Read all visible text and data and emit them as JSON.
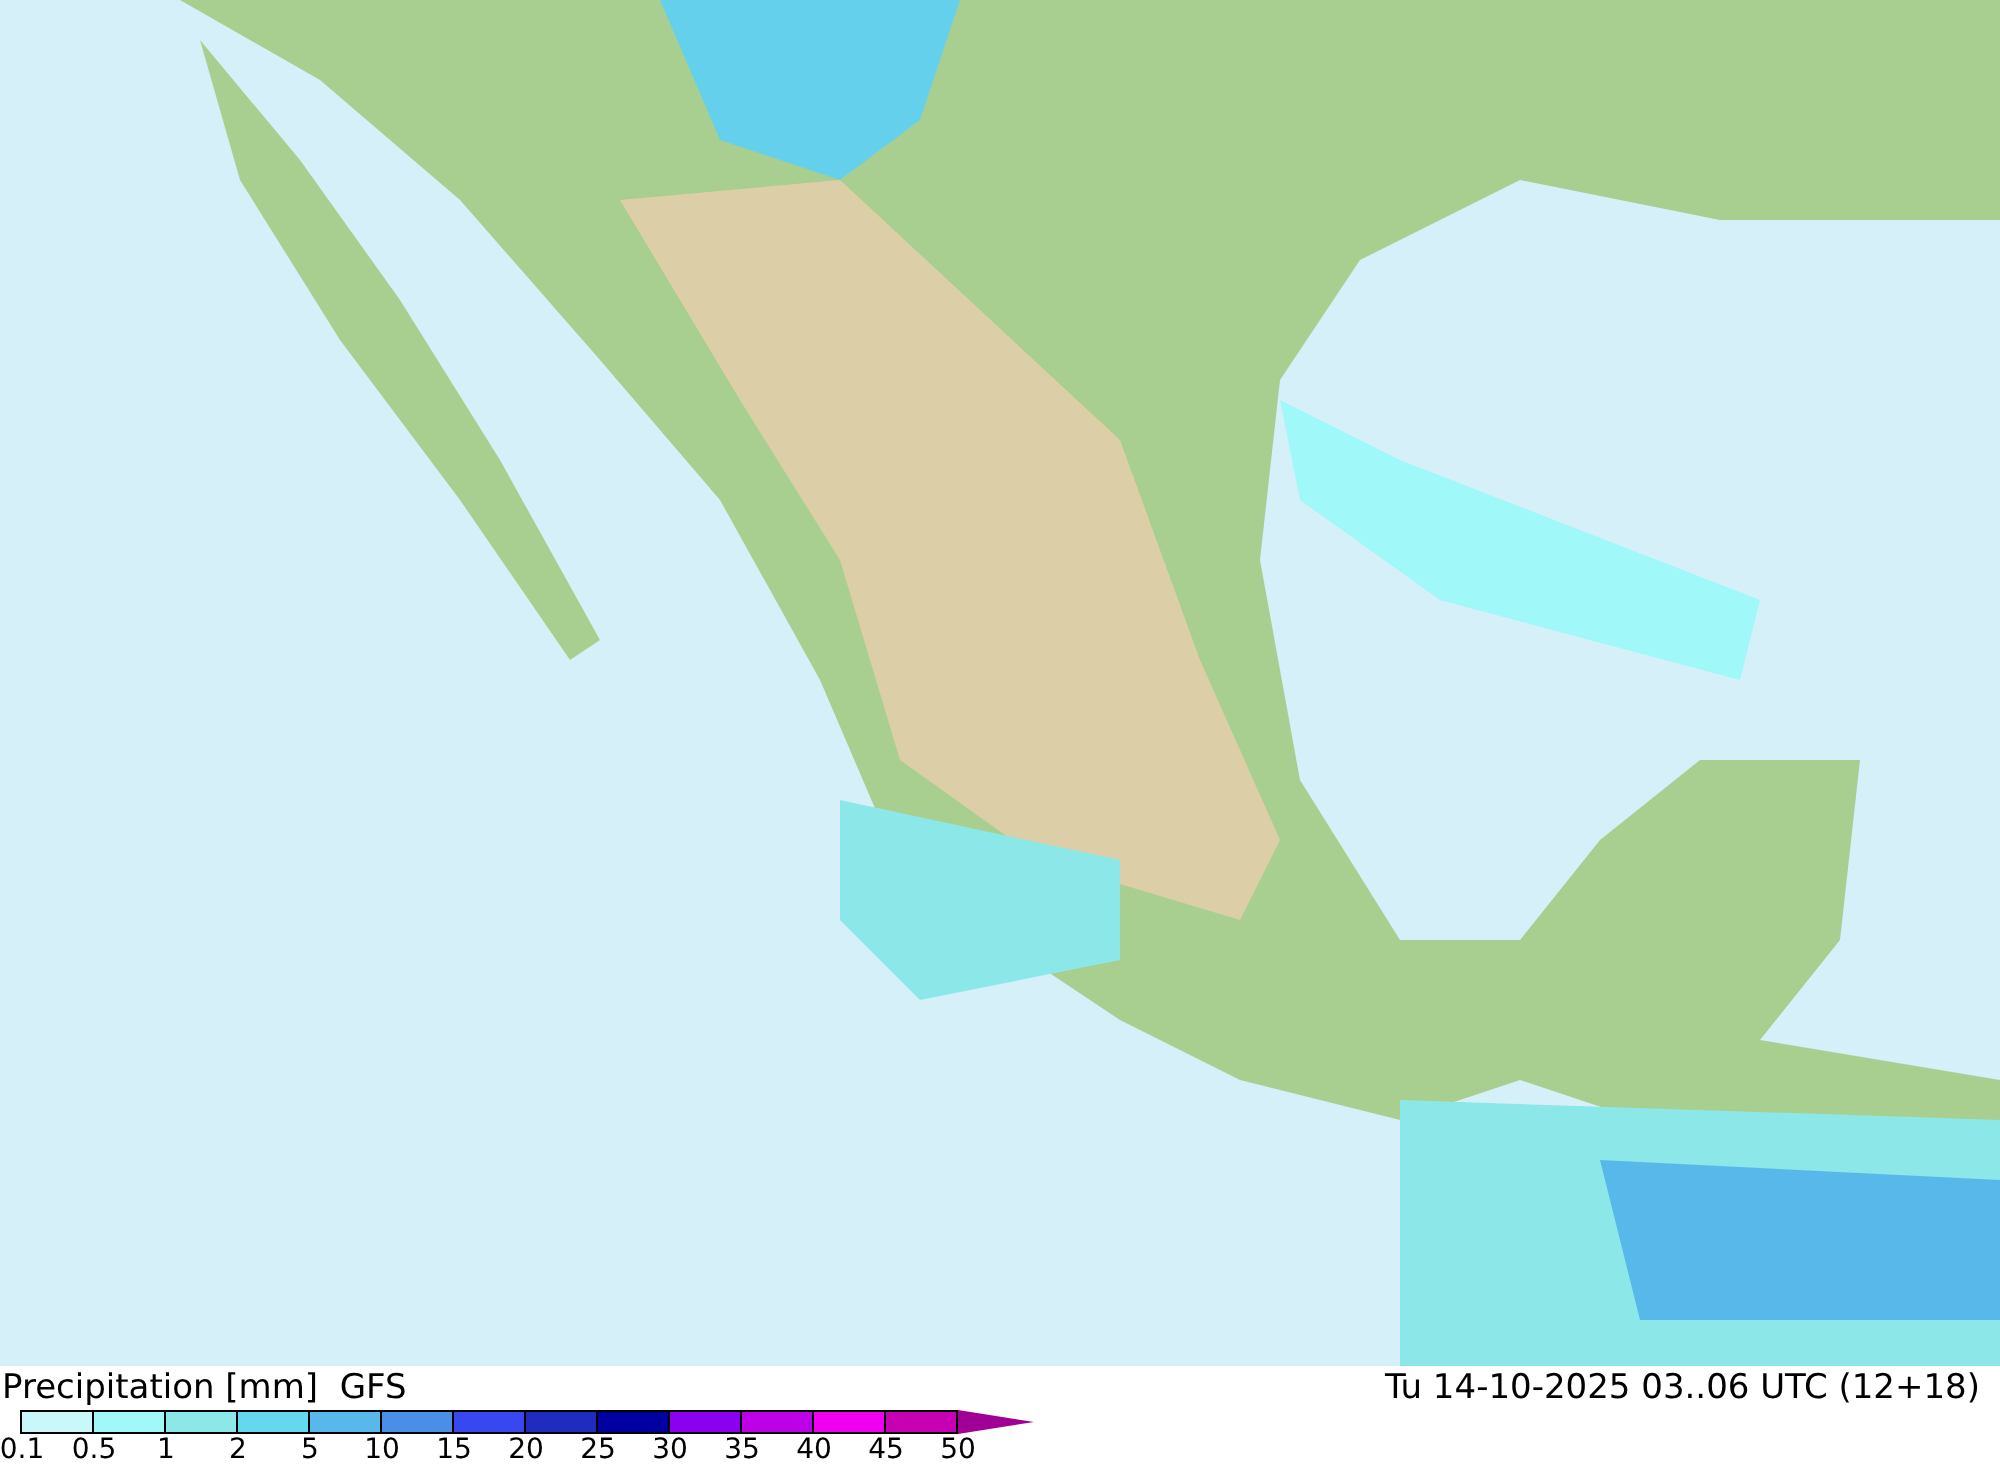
{
  "title": "Precipitation [mm]  GFS",
  "valid_time": "Tu 14-10-2025 03..06 UTC (12+18)",
  "legend": {
    "bins": [
      {
        "color": "#c8f8f8"
      },
      {
        "color": "#a0f8f8"
      },
      {
        "color": "#8ce8e8"
      },
      {
        "color": "#64d8ec"
      },
      {
        "color": "#58b8ea"
      },
      {
        "color": "#4a8ee8"
      },
      {
        "color": "#3848f0"
      },
      {
        "color": "#1e2cc0"
      },
      {
        "color": "#0000a0"
      },
      {
        "color": "#8c00f0"
      },
      {
        "color": "#be00e8"
      },
      {
        "color": "#f000f0"
      },
      {
        "color": "#c800b4"
      },
      {
        "kind": "arrow",
        "color": "#a00096"
      }
    ],
    "labels": [
      "0.1",
      "0.5",
      "1",
      "2",
      "5",
      "10",
      "15",
      "20",
      "25",
      "30",
      "35",
      "40",
      "45",
      "50"
    ]
  }
}
